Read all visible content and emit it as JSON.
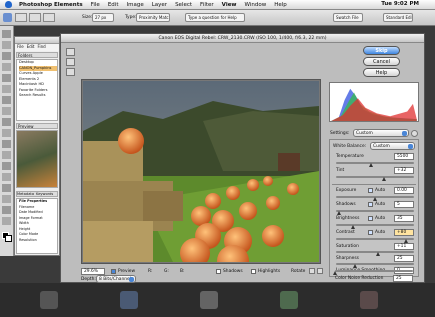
{
  "menubar": {
    "app_name": "Photoshop Elements",
    "items": [
      "File",
      "Edit",
      "Image",
      "Layer",
      "Select",
      "Filter",
      "View",
      "Window",
      "Help"
    ],
    "clock": "Tue 9:02 PM"
  },
  "options_bar": {
    "size_label": "Size:",
    "size_value": "27 px",
    "type_label": "Type:",
    "type_value": "Proximity Match",
    "search_placeholder": "Type a question for Help",
    "swatch_label": "Swatch File",
    "standard_edit_label": "Standard Edit"
  },
  "organizer": {
    "menu": [
      "File",
      "Edit",
      "Find"
    ],
    "tab_folders": "Folders",
    "folder_items": [
      "Desktop",
      "CANON_Pumpkins",
      "Curves Apple",
      "Elements 2",
      "Macintosh HD",
      "Favorite Folders",
      "Search Results"
    ],
    "tab_preview": "Preview",
    "tab_metadata": "Metadata",
    "tab_keywords": "Keywords",
    "meta_header": "File Properties",
    "meta_items": [
      "Filename",
      "Date Modified",
      "Image Format",
      "Width",
      "Height",
      "Color Mode",
      "Resolution"
    ]
  },
  "dialog": {
    "title": "Canon EOS Digital Rebel: CRW_2130.CRW (ISO 100, 1/400, f/6.3, 22 mm)",
    "ok_label": "Skip",
    "cancel_label": "Cancel",
    "help_label": "Help",
    "settings_label": "Settings:",
    "settings_value": "Custom",
    "white_balance_label": "White Balance:",
    "white_balance_value": "Custom",
    "adjustments": [
      {
        "label": "Temperature",
        "value": "5500",
        "slider": 0.45
      },
      {
        "label": "Tint",
        "value": "+32",
        "slider": 0.62
      }
    ],
    "tone": [
      {
        "label": "Exposure",
        "value": "0.00",
        "auto": true,
        "slider": 0.5
      },
      {
        "label": "Shadows",
        "value": "5",
        "auto": true,
        "slider": 0.05
      },
      {
        "label": "Brightness",
        "value": "35",
        "auto": true,
        "slider": 0.23
      },
      {
        "label": "Contrast",
        "value": "+80",
        "auto": true,
        "slider": 0.9
      }
    ],
    "detail": [
      {
        "label": "Saturation",
        "value": "+11",
        "slider": 0.55
      },
      {
        "label": "Sharpness",
        "value": "25",
        "slider": 0.25
      },
      {
        "label": "Luminance Smoothing",
        "value": "0",
        "slider": 0.0
      },
      {
        "label": "Color Noise Reduction",
        "value": "25",
        "slider": 0.25
      }
    ],
    "auto_label": "Auto",
    "zoom_value": "29.6%",
    "preview_label": "Preview",
    "r_label": "R:",
    "g_label": "G:",
    "b_label": "B:",
    "shadows_label": "Shadows",
    "highlights_label": "Highlights",
    "rotate_label": "Rotate",
    "depth_label": "Depth:",
    "depth_value": "8 Bits/Channel"
  },
  "colors": {
    "default_button": "#3f86e0",
    "histogram_red": "#e03030",
    "histogram_blue": "#3050e0",
    "histogram_green": "#30c040"
  }
}
